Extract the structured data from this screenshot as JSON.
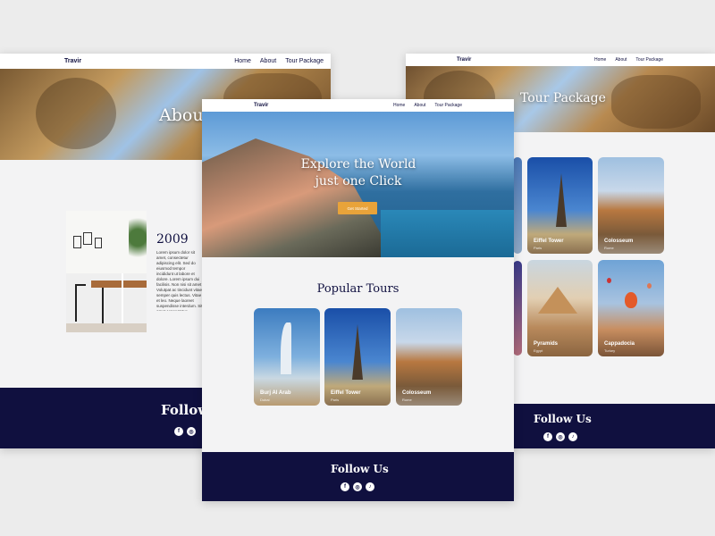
{
  "brand": "Travir",
  "nav": {
    "home": "Home",
    "about": "About",
    "tour_package": "Tour Package"
  },
  "about_page": {
    "title": "About",
    "year": "2009",
    "p1": "Lorem ipsum dolor sit amet, consectetur adipiscing elit. Sed do eiusmod tempor incididunt ut labore et dolore. Lorem ipsum dui facilisis. Non nisi sit amet est. Lorem ipsum dolor sit amet, neque. Et malesuada fames ac turpis egestas. Pellentesque placerat ipsum.",
    "p2": "Volutpat ac tincidunt vitae semper quis lectus. Vitae et leo. Neque laoreet suspendisse interdum. Sit amet consectetur adipiscing elit augue."
  },
  "home_page": {
    "hero_line1": "Explore the World",
    "hero_line2": "just one Click",
    "cta": "Get Started",
    "popular_title": "Popular Tours",
    "cards": [
      {
        "title": "Burj Al Arab",
        "sub": "Dubai"
      },
      {
        "title": "Eiffel Tower",
        "sub": "Paris"
      },
      {
        "title": "Colosseum",
        "sub": "Rome"
      }
    ]
  },
  "package_page": {
    "title": "Tour Package",
    "cards": [
      {
        "title": "Eiffel Tower",
        "sub": "Paris"
      },
      {
        "title": "Colosseum",
        "sub": "Rome"
      },
      {
        "title": "Pyramids",
        "sub": "Egypt"
      },
      {
        "title": "Cappadocia",
        "sub": "Turkey"
      }
    ]
  },
  "footer": {
    "follow": "Follow Us",
    "follow_partial": "Follow",
    "icons": [
      "facebook-icon",
      "instagram-icon",
      "tiktok-icon"
    ]
  },
  "colors": {
    "navy": "#10103f",
    "accent": "#e8a33a",
    "bg": "#f3f3f4"
  }
}
